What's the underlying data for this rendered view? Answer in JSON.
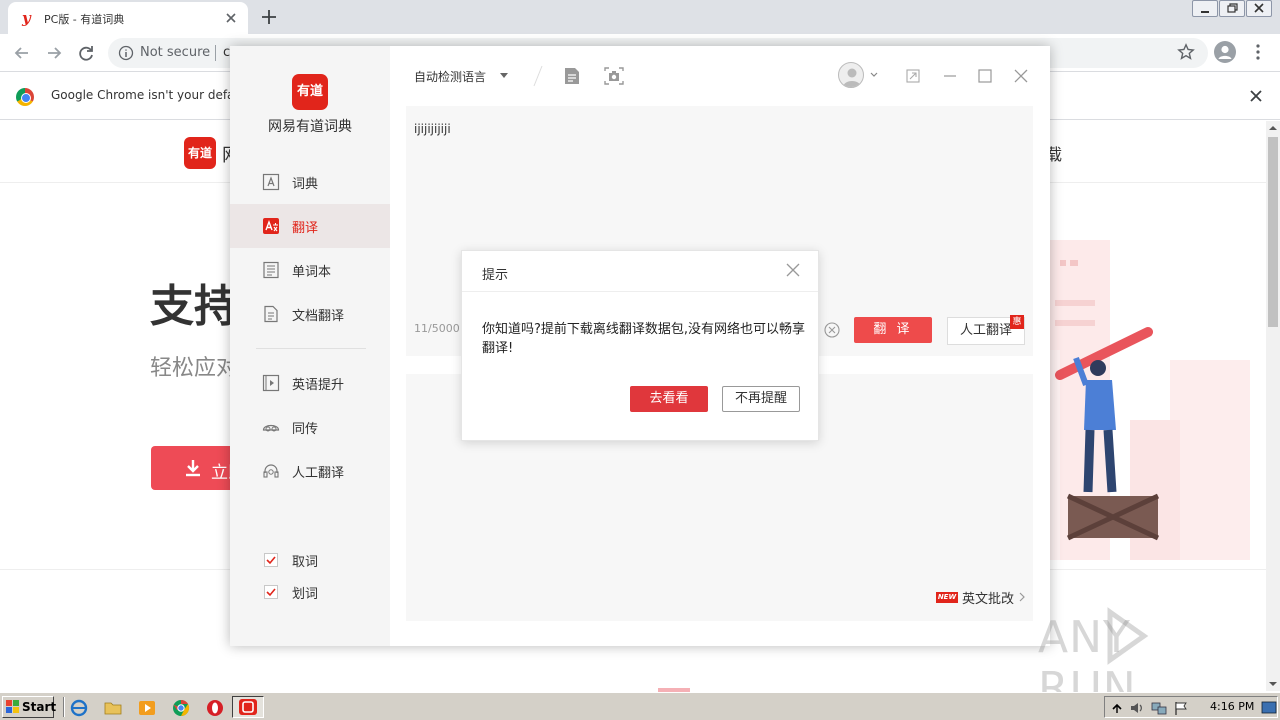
{
  "browser": {
    "tab_title": "PC版 - 有道词典",
    "address_status": "Not secure",
    "address_partial": "c",
    "infobar_text": "Google Chrome isn't your default"
  },
  "website": {
    "logo_text": "有道",
    "brand_partial": "网",
    "nav_partial": "载",
    "hero_title": "支持",
    "hero_sub": "轻松应对",
    "hero_button": "立即"
  },
  "app": {
    "logo_text": "有道",
    "name": "网易有道词典",
    "sidebar": [
      {
        "label": "词典",
        "icon": "dictionary-icon",
        "active": false
      },
      {
        "label": "翻译",
        "icon": "translate-icon",
        "active": true
      },
      {
        "label": "单词本",
        "icon": "wordbook-icon",
        "active": false
      },
      {
        "label": "文档翻译",
        "icon": "document-translate-icon",
        "active": false
      },
      {
        "label": "英语提升",
        "icon": "video-course-icon",
        "active": false
      },
      {
        "label": "同传",
        "icon": "simultaneous-icon",
        "active": false
      },
      {
        "label": "人工翻译",
        "icon": "headset-icon",
        "active": false
      }
    ],
    "checkboxes": [
      {
        "label": "取词",
        "checked": true
      },
      {
        "label": "划词",
        "checked": true
      }
    ],
    "toolbar": {
      "language": "自动检测语言"
    },
    "input": {
      "text": "ijijijijiji",
      "char_count": "11/5000",
      "translate_button": "翻 译",
      "human_button": "人工翻译",
      "human_badge": "惠"
    },
    "output": {
      "new_badge": "NEW",
      "essay_link": "英文批改"
    }
  },
  "modal": {
    "title": "提示",
    "message": "你知道吗?提前下载离线翻译数据包,没有网络也可以畅享翻译!",
    "primary_button": "去看看",
    "secondary_button": "不再提醒"
  },
  "watermark": {
    "text": "ANY RUN"
  },
  "taskbar": {
    "start_label": "Start",
    "clock": "4:16 PM"
  },
  "colors": {
    "brand_red": "#e1251b",
    "button_red": "#ee4b4b"
  }
}
